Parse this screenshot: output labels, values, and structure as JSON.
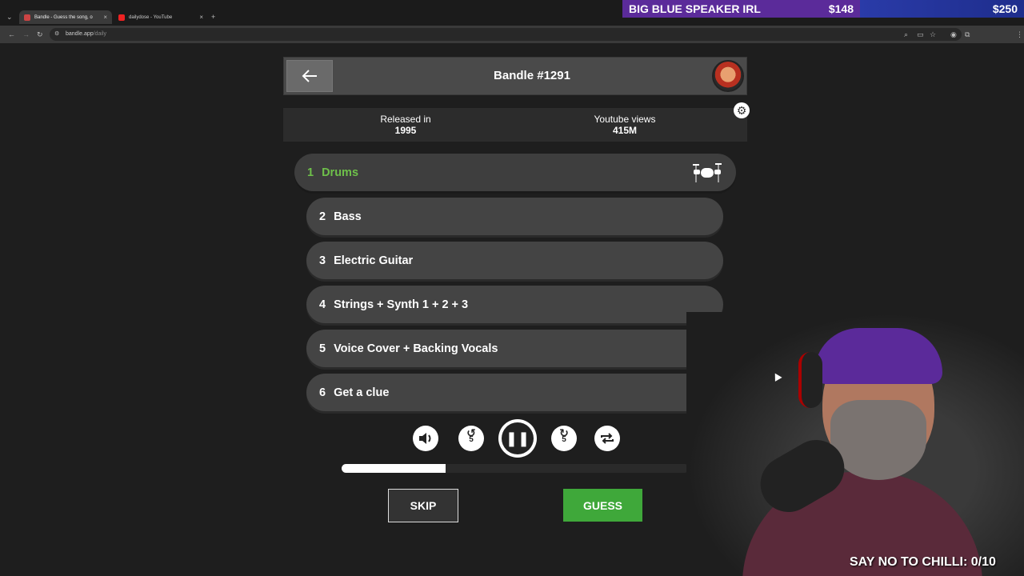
{
  "browser": {
    "tabs": [
      {
        "title": "Bandle - Guess the song, o",
        "active": true
      },
      {
        "title": "dailydose - YouTube",
        "active": false
      }
    ],
    "url_host": "bandle.app",
    "url_path": "/daily"
  },
  "overlay": {
    "banner_label": "BIG BLUE SPEAKER IRL",
    "banner_current": "$148",
    "banner_goal": "$250",
    "bottom_text": "SAY NO TO CHILLI: 0/10"
  },
  "game": {
    "title": "Bandle #1291",
    "released_label": "Released in",
    "released_value": "1995",
    "views_label": "Youtube views",
    "views_value": "415M",
    "stems": [
      {
        "num": "1",
        "label": "Drums",
        "active": true
      },
      {
        "num": "2",
        "label": "Bass"
      },
      {
        "num": "3",
        "label": "Electric Guitar"
      },
      {
        "num": "4",
        "label": "Strings + Synth 1 + 2 + 3"
      },
      {
        "num": "5",
        "label": "Voice Cover + Backing Vocals"
      },
      {
        "num": "6",
        "label": "Get a clue"
      }
    ],
    "rewind_label": "5",
    "forward_label": "5",
    "progress_fraction": 0.3,
    "skip_label": "SKIP",
    "guess_label": "GUESS"
  },
  "colors": {
    "active_stem": "#6ec04a",
    "guess_button": "#3fa83a"
  }
}
